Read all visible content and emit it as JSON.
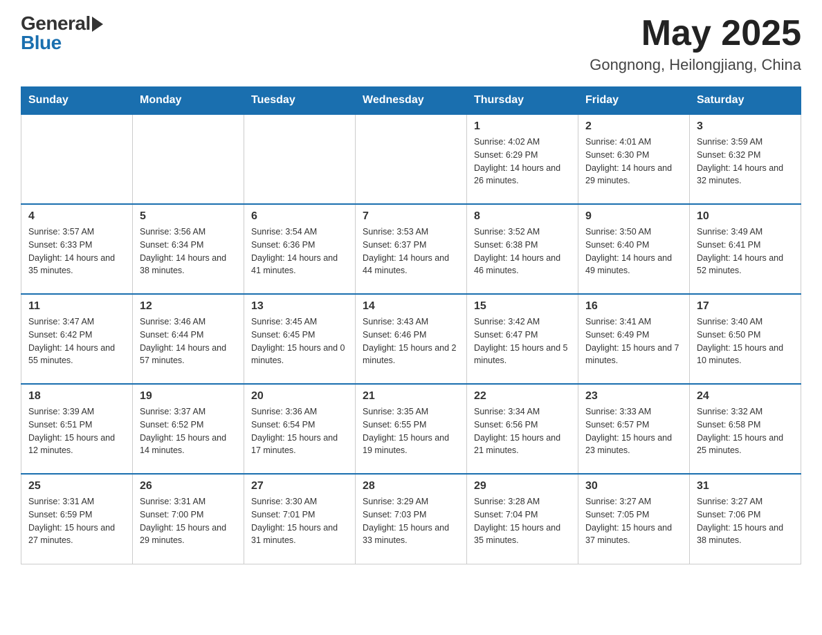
{
  "logo": {
    "general": "General",
    "blue": "Blue"
  },
  "title": {
    "month_year": "May 2025",
    "location": "Gongnong, Heilongjiang, China"
  },
  "weekdays": [
    "Sunday",
    "Monday",
    "Tuesday",
    "Wednesday",
    "Thursday",
    "Friday",
    "Saturday"
  ],
  "weeks": [
    [
      {
        "day": "",
        "info": ""
      },
      {
        "day": "",
        "info": ""
      },
      {
        "day": "",
        "info": ""
      },
      {
        "day": "",
        "info": ""
      },
      {
        "day": "1",
        "info": "Sunrise: 4:02 AM\nSunset: 6:29 PM\nDaylight: 14 hours and 26 minutes."
      },
      {
        "day": "2",
        "info": "Sunrise: 4:01 AM\nSunset: 6:30 PM\nDaylight: 14 hours and 29 minutes."
      },
      {
        "day": "3",
        "info": "Sunrise: 3:59 AM\nSunset: 6:32 PM\nDaylight: 14 hours and 32 minutes."
      }
    ],
    [
      {
        "day": "4",
        "info": "Sunrise: 3:57 AM\nSunset: 6:33 PM\nDaylight: 14 hours and 35 minutes."
      },
      {
        "day": "5",
        "info": "Sunrise: 3:56 AM\nSunset: 6:34 PM\nDaylight: 14 hours and 38 minutes."
      },
      {
        "day": "6",
        "info": "Sunrise: 3:54 AM\nSunset: 6:36 PM\nDaylight: 14 hours and 41 minutes."
      },
      {
        "day": "7",
        "info": "Sunrise: 3:53 AM\nSunset: 6:37 PM\nDaylight: 14 hours and 44 minutes."
      },
      {
        "day": "8",
        "info": "Sunrise: 3:52 AM\nSunset: 6:38 PM\nDaylight: 14 hours and 46 minutes."
      },
      {
        "day": "9",
        "info": "Sunrise: 3:50 AM\nSunset: 6:40 PM\nDaylight: 14 hours and 49 minutes."
      },
      {
        "day": "10",
        "info": "Sunrise: 3:49 AM\nSunset: 6:41 PM\nDaylight: 14 hours and 52 minutes."
      }
    ],
    [
      {
        "day": "11",
        "info": "Sunrise: 3:47 AM\nSunset: 6:42 PM\nDaylight: 14 hours and 55 minutes."
      },
      {
        "day": "12",
        "info": "Sunrise: 3:46 AM\nSunset: 6:44 PM\nDaylight: 14 hours and 57 minutes."
      },
      {
        "day": "13",
        "info": "Sunrise: 3:45 AM\nSunset: 6:45 PM\nDaylight: 15 hours and 0 minutes."
      },
      {
        "day": "14",
        "info": "Sunrise: 3:43 AM\nSunset: 6:46 PM\nDaylight: 15 hours and 2 minutes."
      },
      {
        "day": "15",
        "info": "Sunrise: 3:42 AM\nSunset: 6:47 PM\nDaylight: 15 hours and 5 minutes."
      },
      {
        "day": "16",
        "info": "Sunrise: 3:41 AM\nSunset: 6:49 PM\nDaylight: 15 hours and 7 minutes."
      },
      {
        "day": "17",
        "info": "Sunrise: 3:40 AM\nSunset: 6:50 PM\nDaylight: 15 hours and 10 minutes."
      }
    ],
    [
      {
        "day": "18",
        "info": "Sunrise: 3:39 AM\nSunset: 6:51 PM\nDaylight: 15 hours and 12 minutes."
      },
      {
        "day": "19",
        "info": "Sunrise: 3:37 AM\nSunset: 6:52 PM\nDaylight: 15 hours and 14 minutes."
      },
      {
        "day": "20",
        "info": "Sunrise: 3:36 AM\nSunset: 6:54 PM\nDaylight: 15 hours and 17 minutes."
      },
      {
        "day": "21",
        "info": "Sunrise: 3:35 AM\nSunset: 6:55 PM\nDaylight: 15 hours and 19 minutes."
      },
      {
        "day": "22",
        "info": "Sunrise: 3:34 AM\nSunset: 6:56 PM\nDaylight: 15 hours and 21 minutes."
      },
      {
        "day": "23",
        "info": "Sunrise: 3:33 AM\nSunset: 6:57 PM\nDaylight: 15 hours and 23 minutes."
      },
      {
        "day": "24",
        "info": "Sunrise: 3:32 AM\nSunset: 6:58 PM\nDaylight: 15 hours and 25 minutes."
      }
    ],
    [
      {
        "day": "25",
        "info": "Sunrise: 3:31 AM\nSunset: 6:59 PM\nDaylight: 15 hours and 27 minutes."
      },
      {
        "day": "26",
        "info": "Sunrise: 3:31 AM\nSunset: 7:00 PM\nDaylight: 15 hours and 29 minutes."
      },
      {
        "day": "27",
        "info": "Sunrise: 3:30 AM\nSunset: 7:01 PM\nDaylight: 15 hours and 31 minutes."
      },
      {
        "day": "28",
        "info": "Sunrise: 3:29 AM\nSunset: 7:03 PM\nDaylight: 15 hours and 33 minutes."
      },
      {
        "day": "29",
        "info": "Sunrise: 3:28 AM\nSunset: 7:04 PM\nDaylight: 15 hours and 35 minutes."
      },
      {
        "day": "30",
        "info": "Sunrise: 3:27 AM\nSunset: 7:05 PM\nDaylight: 15 hours and 37 minutes."
      },
      {
        "day": "31",
        "info": "Sunrise: 3:27 AM\nSunset: 7:06 PM\nDaylight: 15 hours and 38 minutes."
      }
    ]
  ]
}
